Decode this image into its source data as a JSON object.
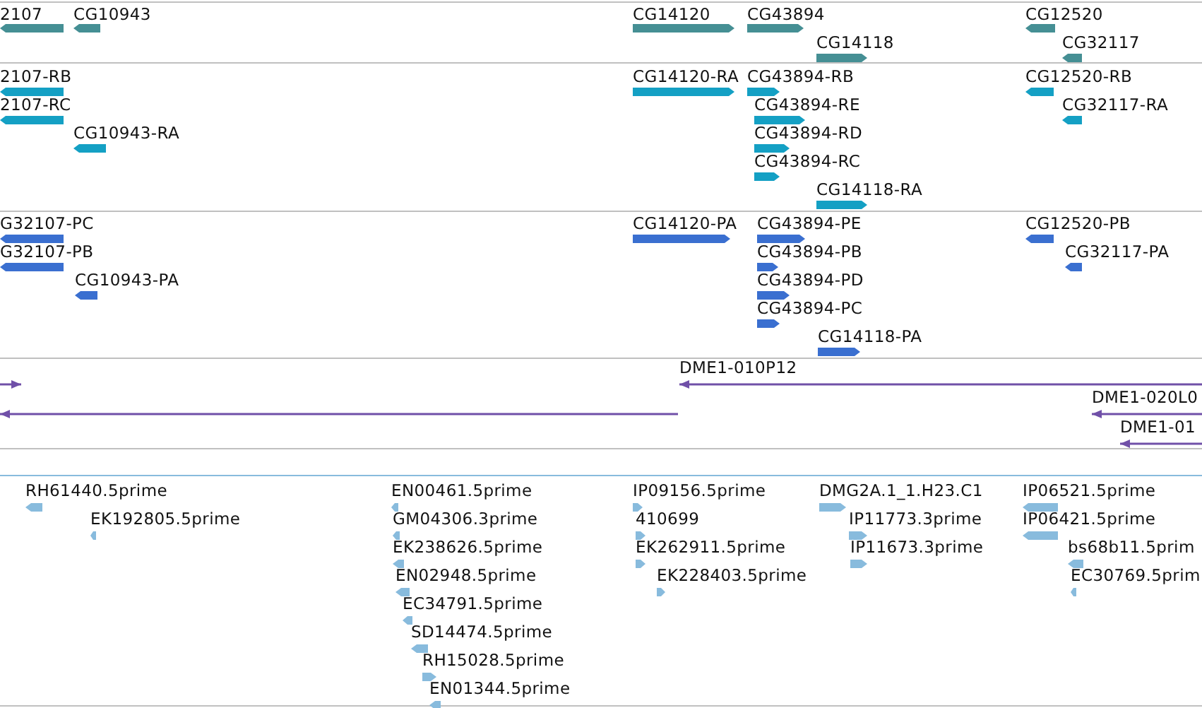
{
  "tracks": [
    {
      "kind": "block",
      "color": "#458f94",
      "features": [
        {
          "label": "2107",
          "reverse": true
        },
        {
          "label": "CG10943",
          "reverse": true
        },
        {
          "label": "CG14120",
          "reverse": false
        },
        {
          "label": "CG43894",
          "reverse": false
        },
        {
          "label": "CG14118",
          "reverse": false
        },
        {
          "label": "CG12520",
          "reverse": true
        },
        {
          "label": "CG32117",
          "reverse": true
        }
      ]
    },
    {
      "kind": "block",
      "color": "#14a0c4",
      "features": [
        {
          "label": "2107-RB",
          "reverse": true
        },
        {
          "label": "2107-RC",
          "reverse": true
        },
        {
          "label": "CG10943-RA",
          "reverse": true
        },
        {
          "label": "CG14120-RA",
          "reverse": false
        },
        {
          "label": "CG43894-RB",
          "reverse": false
        },
        {
          "label": "CG43894-RE",
          "reverse": false
        },
        {
          "label": "CG43894-RD",
          "reverse": false
        },
        {
          "label": "CG43894-RC",
          "reverse": false
        },
        {
          "label": "CG14118-RA",
          "reverse": false
        },
        {
          "label": "CG12520-RB",
          "reverse": true
        },
        {
          "label": "CG32117-RA",
          "reverse": true
        }
      ]
    },
    {
      "kind": "block",
      "color": "#3a6fd0",
      "features": [
        {
          "label": "G32107-PC",
          "reverse": true
        },
        {
          "label": "G32107-PB",
          "reverse": true
        },
        {
          "label": "CG10943-PA",
          "reverse": true
        },
        {
          "label": "CG14120-PA",
          "reverse": false
        },
        {
          "label": "CG43894-PE",
          "reverse": false
        },
        {
          "label": "CG43894-PB",
          "reverse": false
        },
        {
          "label": "CG43894-PD",
          "reverse": false
        },
        {
          "label": "CG43894-PC",
          "reverse": false
        },
        {
          "label": "CG14118-PA",
          "reverse": false
        },
        {
          "label": "CG12520-PB",
          "reverse": true
        },
        {
          "label": "CG32117-PA",
          "reverse": true
        }
      ]
    },
    {
      "kind": "line",
      "color": "#7050a8",
      "features": [
        {
          "reverse": false
        },
        {
          "reverse": true
        },
        {
          "label": "DME1-010P12",
          "reverse": true
        },
        {
          "label": "DME1-020L0",
          "reverse": true
        },
        {
          "label": "DME1-01",
          "reverse": true
        }
      ]
    },
    {
      "kind": "empty"
    },
    {
      "kind": "block",
      "color": "#88bbdd",
      "features": [
        {
          "label": "RH61440.5prime",
          "reverse": true
        },
        {
          "label": "EK192805.5prime",
          "reverse": true
        },
        {
          "label": "EN00461.5prime",
          "reverse": true
        },
        {
          "label": "GM04306.3prime",
          "reverse": true
        },
        {
          "label": "EK238626.5prime",
          "reverse": true
        },
        {
          "label": "EN02948.5prime",
          "reverse": true
        },
        {
          "label": "EC34791.5prime",
          "reverse": true
        },
        {
          "label": "SD14474.5prime",
          "reverse": true
        },
        {
          "label": "RH15028.5prime",
          "reverse": false
        },
        {
          "label": "EN01344.5prime",
          "reverse": true
        },
        {
          "label": "IP09156.5prime",
          "reverse": false
        },
        {
          "label": "410699",
          "reverse": false
        },
        {
          "label": "EK262911.5prime",
          "reverse": false
        },
        {
          "label": "EK228403.5prime",
          "reverse": false
        },
        {
          "label": "DMG2A.1_1.H23.C1",
          "reverse": false
        },
        {
          "label": "IP11773.3prime",
          "reverse": false
        },
        {
          "label": "IP11673.3prime",
          "reverse": false
        },
        {
          "label": "IP06521.5prime",
          "reverse": true
        },
        {
          "label": "IP06421.5prime",
          "reverse": true
        },
        {
          "label": "bs68b11.5prim",
          "reverse": true
        },
        {
          "label": "EC30769.5prim",
          "reverse": true
        }
      ]
    }
  ]
}
